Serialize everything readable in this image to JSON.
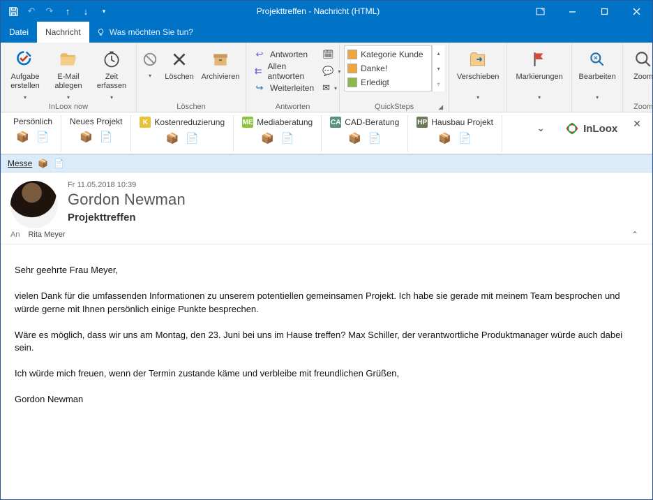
{
  "title": "Projekttreffen  -  Nachricht (HTML)",
  "tabs": {
    "file": "Datei",
    "message": "Nachricht",
    "tell": "Was möchten Sie tun?"
  },
  "ribbon": {
    "inloox_now": {
      "label": "InLoox now",
      "task_create": "Aufgabe\nerstellen",
      "email_file": "E-Mail\nablegen",
      "time_track": "Zeit\nerfassen"
    },
    "delete_group": {
      "label": "Löschen",
      "delete": "Löschen",
      "archive": "Archivieren"
    },
    "respond_group": {
      "label": "Antworten",
      "reply": "Antworten",
      "reply_all": "Allen antworten",
      "forward": "Weiterleiten"
    },
    "quicksteps": {
      "label": "QuickSteps",
      "items": [
        "Kategorie Kunde",
        "Danke!",
        "Erledigt"
      ],
      "colors": [
        "#f0a63a",
        "#f0a63a",
        "#8fb84a"
      ]
    },
    "move_group": {
      "label": "Verschieben"
    },
    "tags_group": {
      "label": "Markierungen"
    },
    "edit_group": {
      "label": "Bearbeiten"
    },
    "zoom_group": {
      "label": "Zoom",
      "zoom": "Zoom"
    }
  },
  "projects": {
    "personal": "Persönlich",
    "new_project": "Neues Projekt",
    "items": [
      {
        "badge": "K",
        "color": "#e8c23a",
        "name": "Kostenreduzierung"
      },
      {
        "badge": "ME",
        "color": "#8cc63e",
        "name": "Mediaberatung"
      },
      {
        "badge": "CA",
        "color": "#5a917a",
        "name": "CAD-Beratung"
      },
      {
        "badge": "HP",
        "color": "#6b7b55",
        "name": "Hausbau Projekt"
      }
    ],
    "brand": "InLoox"
  },
  "messe": {
    "label": "Messe"
  },
  "mail": {
    "date": "Fr 11.05.2018 10:39",
    "from": "Gordon Newman",
    "subject": "Projekttreffen",
    "to_label": "An",
    "to": "Rita Meyer",
    "body": {
      "p1": "Sehr geehrte Frau Meyer,",
      "p2": "vielen Dank für die umfassenden Informationen zu unserem potentiellen gemeinsamen Projekt. Ich habe sie gerade mit meinem Team besprochen und würde gerne mit Ihnen persönlich einige Punkte besprechen.",
      "p3": "Wäre es möglich, dass wir uns am Montag, den 23. Juni bei uns im Hause treffen? Max Schiller, der verantwortliche Produktmanager würde auch dabei sein.",
      "p4": "Ich würde mich freuen, wenn der Termin zustande käme und verbleibe mit freundlichen Grüßen,",
      "p5": "Gordon Newman"
    }
  }
}
